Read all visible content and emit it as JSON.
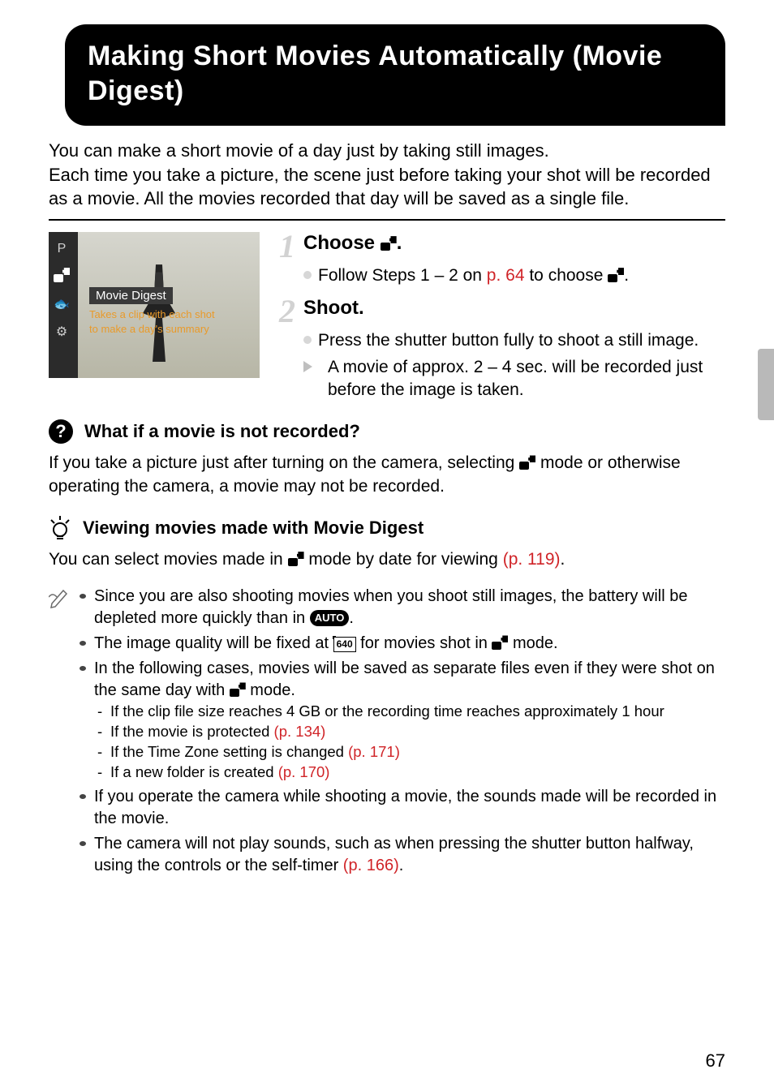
{
  "title": "Making Short Movies Automatically (Movie Digest)",
  "intro": "You can make a short movie of a day just by taking still images.\nEach time you take a picture, the scene just before taking your shot will be recorded as a movie. All the movies recorded that day will be saved as a single file.",
  "screenshot": {
    "left_icons": [
      "P",
      "[md]",
      "🐟",
      "⚙"
    ],
    "mode_title": "Movie Digest",
    "mode_desc_line1": "Takes a clip with each shot",
    "mode_desc_line2": "to make a day's summary"
  },
  "steps": [
    {
      "num": "1",
      "title_pre": "Choose ",
      "title_post": ".",
      "body": [
        {
          "type": "dot",
          "pre": "Follow Steps 1 – 2 on ",
          "link": "p. 64",
          "post": " to choose ",
          "icon_after": true,
          "tail": "."
        }
      ]
    },
    {
      "num": "2",
      "title_pre": "Shoot.",
      "title_post": "",
      "body": [
        {
          "type": "dot",
          "text": "Press the shutter button fully to shoot a still image."
        },
        {
          "type": "tri",
          "text": "A movie of approx. 2 – 4 sec. will be recorded just before the image is taken."
        }
      ]
    }
  ],
  "qa": {
    "heading": "What if a movie is not recorded?",
    "body_pre": "If you take a picture just after turning on the camera, selecting ",
    "body_post": " mode or otherwise operating the camera, a movie may not be recorded."
  },
  "tip": {
    "heading": "Viewing movies made with Movie Digest",
    "body_pre": "You can select movies made in ",
    "body_mid": " mode by date for viewing ",
    "body_link": "(p. 119)",
    "body_post": "."
  },
  "notes": [
    {
      "segments": [
        {
          "t": "Since you are also shooting movies when you shoot still images, the battery will be depleted more quickly than in "
        },
        {
          "pill": "AUTO"
        },
        {
          "t": "."
        }
      ]
    },
    {
      "segments": [
        {
          "t": "The image quality will be fixed at "
        },
        {
          "res": "640"
        },
        {
          "t": " for movies shot in "
        },
        {
          "icon": true
        },
        {
          "t": " mode."
        }
      ]
    },
    {
      "segments": [
        {
          "t": "In the following cases, movies will be saved as separate files even if they were shot on the same day with "
        },
        {
          "icon": true
        },
        {
          "t": " mode."
        }
      ],
      "sub": [
        {
          "t": "If the clip file size reaches 4 GB or the recording time reaches approximately 1 hour"
        },
        {
          "t": "If the movie is protected ",
          "link": "(p. 134)"
        },
        {
          "t": "If the Time Zone setting is changed ",
          "link": "(p. 171)"
        },
        {
          "t": "If a new folder is created ",
          "link": "(p. 170)"
        }
      ]
    },
    {
      "segments": [
        {
          "t": "If you operate the camera while shooting a movie, the sounds made will be recorded in the movie."
        }
      ]
    },
    {
      "segments": [
        {
          "t": "The camera will not play sounds, such as when pressing the shutter button halfway, using the controls or the self-timer "
        },
        {
          "link": "(p. 166)"
        },
        {
          "t": "."
        }
      ]
    }
  ],
  "page_number": "67"
}
